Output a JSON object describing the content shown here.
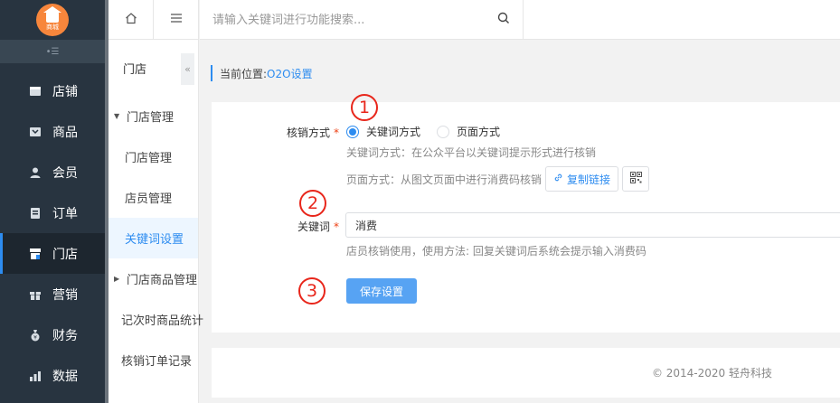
{
  "app": {
    "logo_text": "商城"
  },
  "sidebar": {
    "items": [
      {
        "label": "店铺",
        "icon": "store-icon"
      },
      {
        "label": "商品",
        "icon": "goods-icon"
      },
      {
        "label": "会员",
        "icon": "user-icon"
      },
      {
        "label": "订单",
        "icon": "order-icon"
      },
      {
        "label": "门店",
        "icon": "shop-icon",
        "active": true
      },
      {
        "label": "营销",
        "icon": "gift-icon"
      },
      {
        "label": "财务",
        "icon": "money-bag-icon"
      },
      {
        "label": "数据",
        "icon": "bar-chart-icon"
      }
    ]
  },
  "subnav": {
    "title": "门店",
    "fold_glyph": "«",
    "items": [
      {
        "label": "门店管理",
        "type": "group",
        "expanded": true
      },
      {
        "label": "门店管理",
        "type": "sub"
      },
      {
        "label": "店员管理",
        "type": "sub"
      },
      {
        "label": "关键词设置",
        "type": "sub",
        "active": true
      },
      {
        "label": "门店商品管理",
        "type": "group",
        "expanded": false
      },
      {
        "label": "记次时商品统计",
        "type": "plain"
      },
      {
        "label": "核销订单记录",
        "type": "plain"
      }
    ]
  },
  "search": {
    "placeholder": "请输入关键词进行功能搜索..."
  },
  "breadcrumb": {
    "prefix": "当前位置:",
    "location": "O2O设置"
  },
  "form": {
    "method_label": "核销方式",
    "required_mark": "*",
    "options": [
      {
        "label": "关键词方式",
        "selected": true
      },
      {
        "label": "页面方式",
        "selected": false
      }
    ],
    "hint_keyword": "关键词方式：在公众平台以关键词提示形式进行核销",
    "hint_page": "页面方式：从图文页面中进行消费码核销",
    "copy_link_label": "复制链接",
    "keyword_label": "关键词",
    "keyword_value": "消费",
    "keyword_hint": "店员核销使用，使用方法: 回复关键词后系统会提示输入消费码",
    "save_label": "保存设置"
  },
  "annotations": {
    "one": "1",
    "two": "2",
    "three": "3"
  },
  "footer": {
    "copyright": "© 2014-2020 轻舟科技"
  },
  "colors": {
    "sidebar_bg": "#283440",
    "accent": "#2d8cf0",
    "logo": "#f7863c",
    "annotation": "#e8261b",
    "save_button": "#57a3f3"
  }
}
